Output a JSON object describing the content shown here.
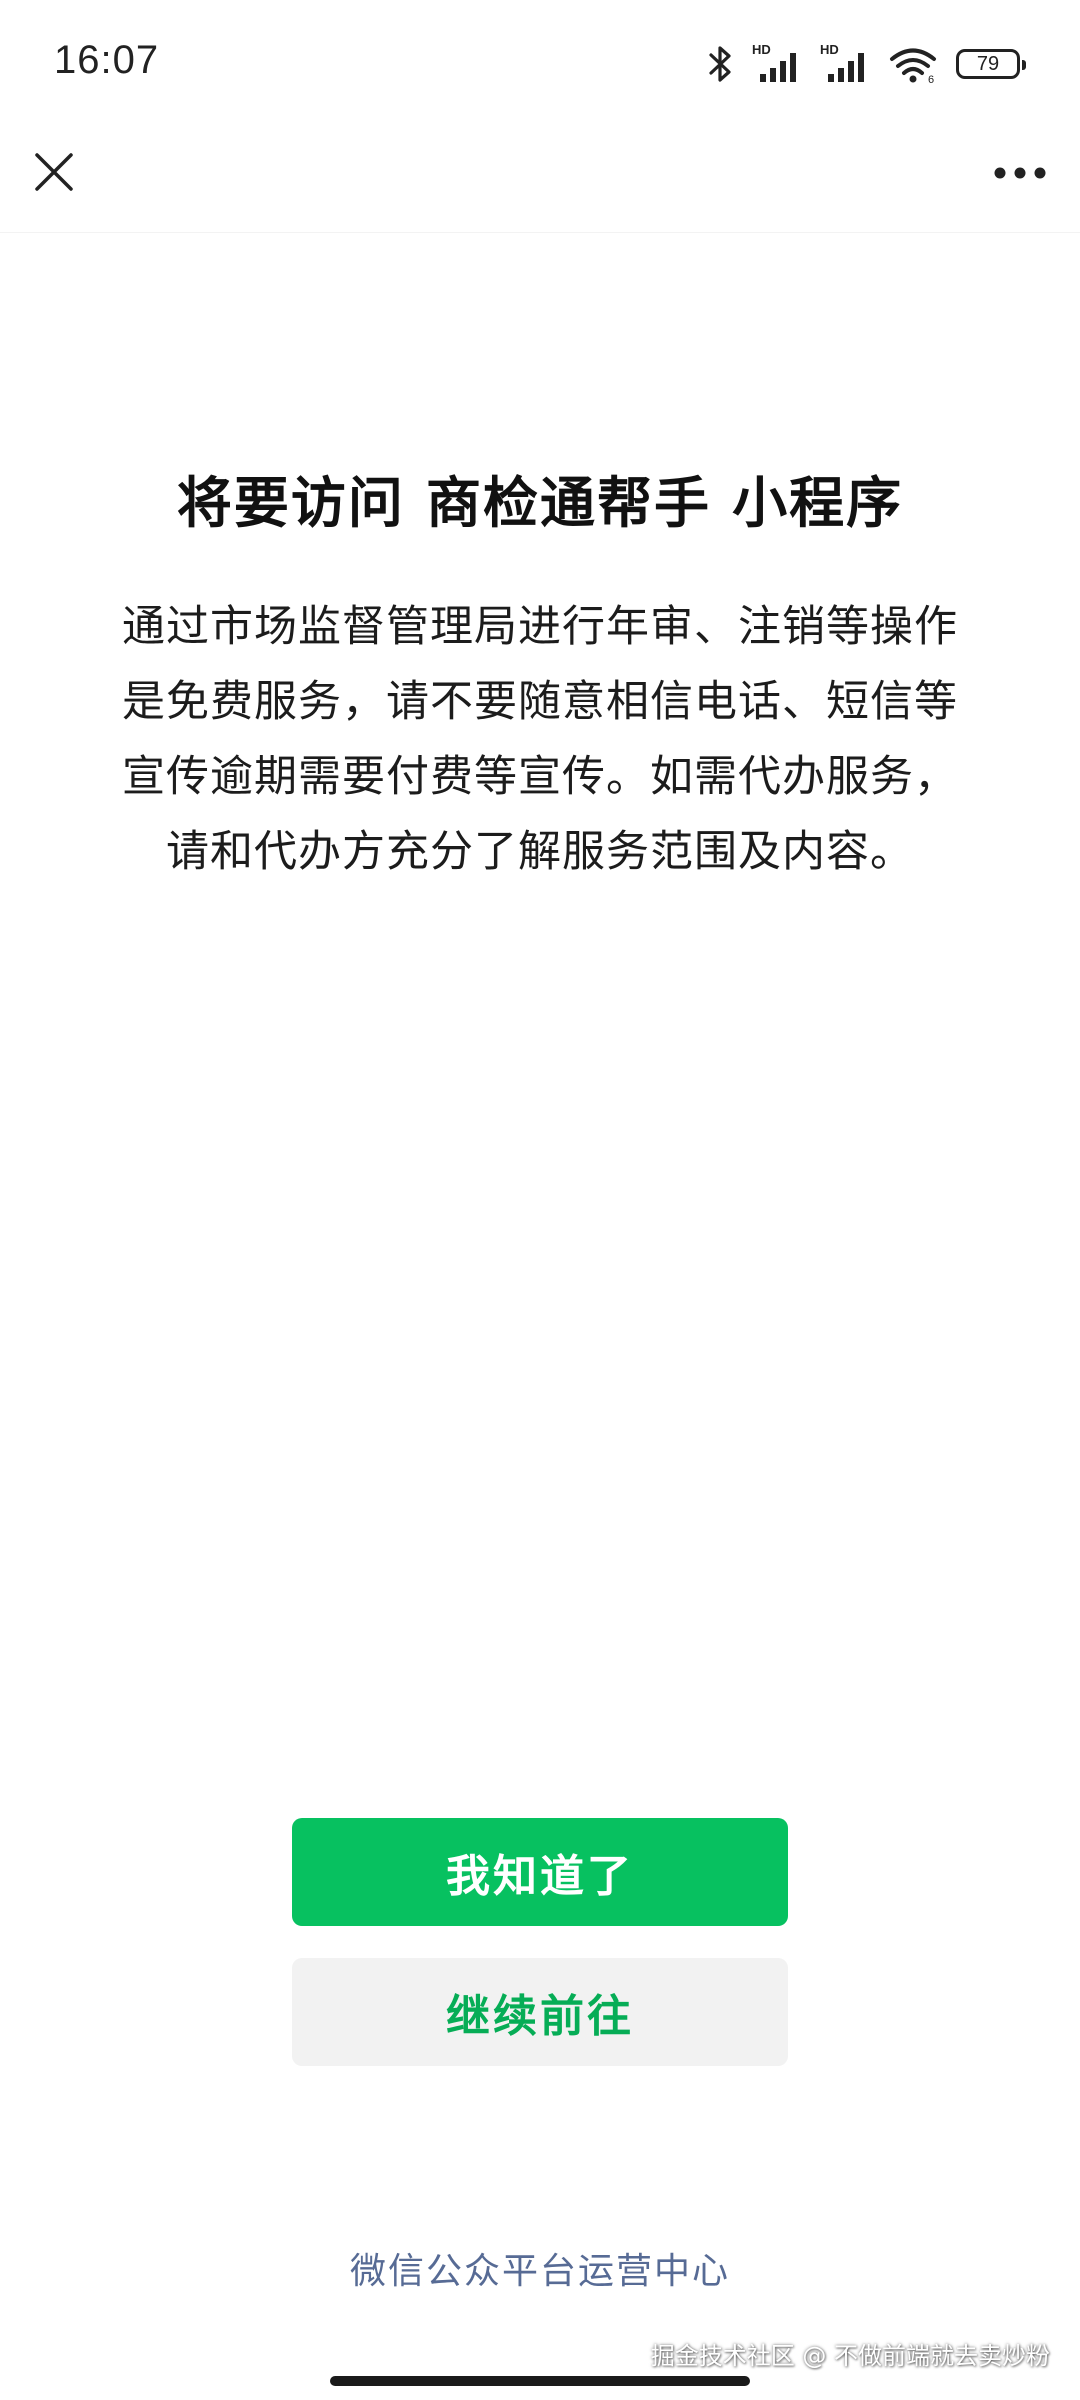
{
  "status_bar": {
    "time": "16:07",
    "icons": [
      "bluetooth-icon",
      "hd-signal-icon",
      "hd-signal-icon",
      "wifi-icon",
      "battery-icon"
    ],
    "hd_label": "HD",
    "battery_level": "79"
  },
  "nav": {
    "close_icon": "close-icon",
    "more_icon": "more-dots-icon"
  },
  "main": {
    "title": "将要访问 商检通帮手 小程序",
    "notice_lines": [
      "通过市场监督管理局进行年审、注销等操作",
      "是免费服务，请不要随意相信电话、短信等",
      "宣传逾期需要付费等宣传。如需代办服务，",
      "请和代办方充分了解服务范围及内容。"
    ]
  },
  "buttons": {
    "primary_label": "我知道了",
    "secondary_label": "继续前往"
  },
  "footer": {
    "link_label": "微信公众平台运营中心",
    "watermark": "掘金技术社区 @ 不做前端就去卖炒粉"
  },
  "colors": {
    "primary_green": "#07c160",
    "secondary_text_green": "#06ad56",
    "secondary_bg": "#f2f2f2",
    "link_blue": "#576b95"
  }
}
